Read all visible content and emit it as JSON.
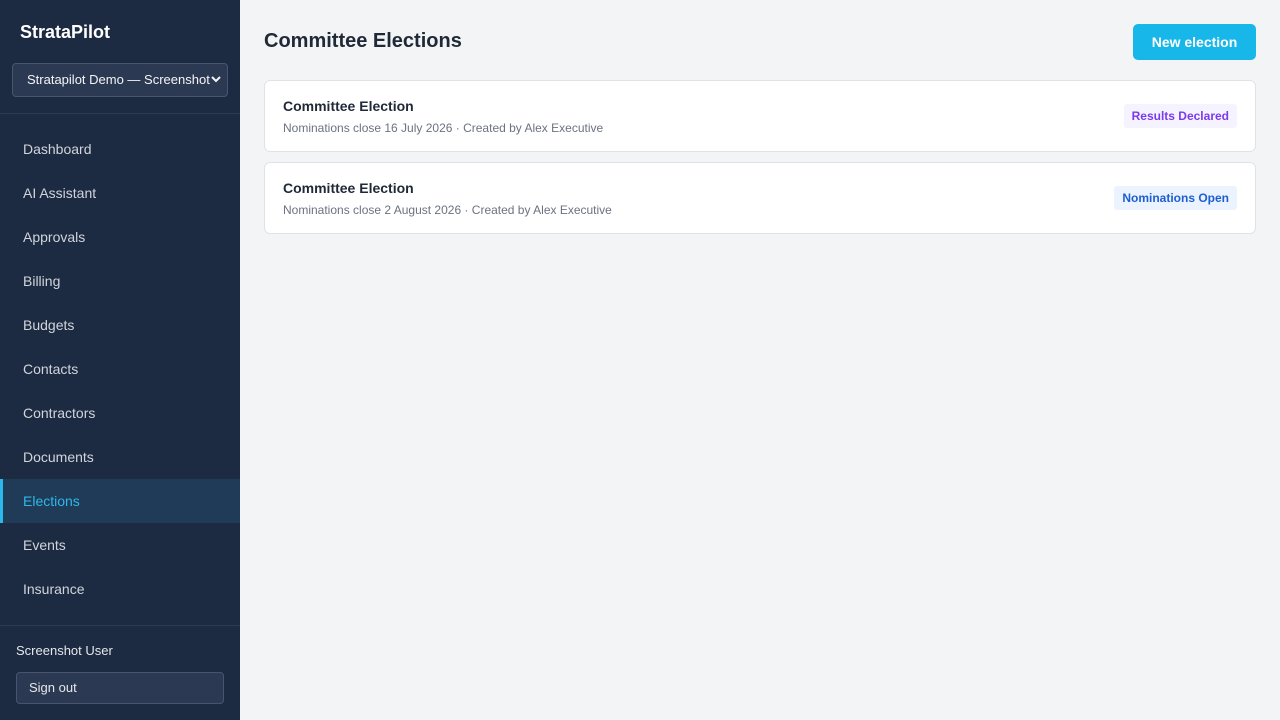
{
  "app": {
    "brand": "StrataPilot"
  },
  "org_selector": {
    "value": "Stratapilot Demo — Screenshot"
  },
  "nav": [
    {
      "label": "Dashboard",
      "active": false
    },
    {
      "label": "AI Assistant",
      "active": false
    },
    {
      "label": "Approvals",
      "active": false
    },
    {
      "label": "Billing",
      "active": false
    },
    {
      "label": "Budgets",
      "active": false
    },
    {
      "label": "Contacts",
      "active": false
    },
    {
      "label": "Contractors",
      "active": false
    },
    {
      "label": "Documents",
      "active": false
    },
    {
      "label": "Elections",
      "active": true
    },
    {
      "label": "Events",
      "active": false
    },
    {
      "label": "Insurance",
      "active": false
    }
  ],
  "user": {
    "name": "Screenshot User",
    "sign_out_label": "Sign out"
  },
  "page": {
    "title": "Committee Elections",
    "new_button_label": "New election"
  },
  "elections": [
    {
      "title": "Committee Election",
      "meta": "Nominations close 16 July 2026 · Created by Alex Executive",
      "status": "Results Declared",
      "status_color": "#7c3aed",
      "status_bg": "#f5f3ff"
    },
    {
      "title": "Committee Election",
      "meta": "Nominations close 2 August 2026 · Created by Alex Executive",
      "status": "Nominations Open",
      "status_color": "#1d5fd1",
      "status_bg": "#eaf3fe"
    }
  ],
  "colors": {
    "sidebar_bg": "#1c2a42",
    "accent": "#18b7ea",
    "active_nav_text": "#2cb8ea"
  }
}
